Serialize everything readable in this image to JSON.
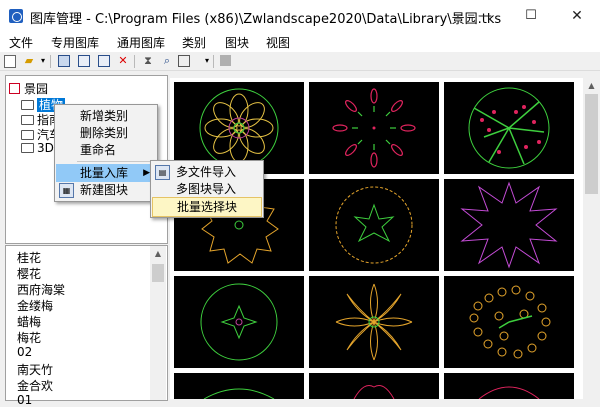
{
  "window": {
    "title": "图库管理 - C:\\Program Files (x86)\\Zwlandscape2020\\Data\\Library\\景园.tks",
    "minimize": "—",
    "maximize": "☐",
    "close": "✕"
  },
  "menu": [
    "文件",
    "专用图库",
    "通用图库",
    "类别",
    "图块",
    "视图"
  ],
  "tree": {
    "root": "景园",
    "children": [
      "植物",
      "指南",
      "汽车",
      "3D"
    ]
  },
  "context_menu": {
    "items": [
      "新增类别",
      "删除类别",
      "重命名",
      "批量入库",
      "新建图块"
    ]
  },
  "submenu": {
    "items": [
      "多文件导入",
      "多图块导入",
      "批量选择块"
    ]
  },
  "block_list": [
    "桂花",
    "樱花",
    "西府海棠",
    "金缕梅",
    "蜡梅",
    "梅花",
    "02",
    "南天竹",
    "金合欢",
    "01"
  ],
  "colors": {
    "selection": "#0078d7",
    "menu_highlight": "#91c9f7",
    "submenu_highlight": "#fdf6c5",
    "thumbnail_background": "#000000"
  }
}
